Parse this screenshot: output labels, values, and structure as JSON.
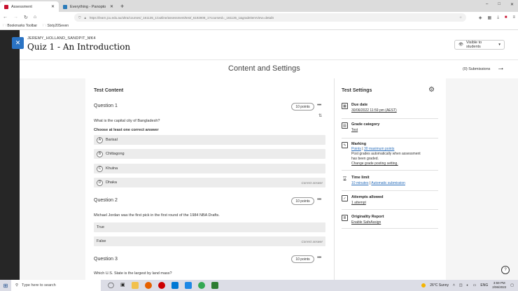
{
  "browser": {
    "tabs": [
      {
        "title": "Assessment",
        "active": true
      },
      {
        "title": "Everything - Panopto",
        "active": false
      }
    ],
    "new_tab": "+",
    "window_controls": [
      "–",
      "□",
      "✕"
    ],
    "url": "https://learn.jcu.edu.au/ultra/courses/_161135_1/outline/assessment/test/_6192808_1?courseId=_161135_1&gradeitemView=details",
    "bookmarks": [
      "Bookmarks Toolbar",
      "Sixty20Seven"
    ]
  },
  "header": {
    "user": "JEREMY_HOLLAND_SANDPIT_MK4",
    "title": "Quiz 1 - An Introduction",
    "visibility": "Visible to students",
    "visibility_caret": "▾",
    "close": "✕"
  },
  "subheader": {
    "title": "Content and Settings",
    "submissions": "(0) Submissions",
    "arrow": "→"
  },
  "test_content": {
    "heading": "Test Content",
    "questions": [
      {
        "label": "Question 1",
        "points": "10 points",
        "text": "What is the capital city of Bangladesh?",
        "instruction": "Choose at least one correct answer",
        "options": [
          {
            "letter": "A",
            "text": "Barisal",
            "correct": ""
          },
          {
            "letter": "B",
            "text": "Chittagong",
            "correct": ""
          },
          {
            "letter": "C",
            "text": "Khulna",
            "correct": ""
          },
          {
            "letter": "D",
            "text": "Dhaka",
            "correct": "Correct answer"
          }
        ]
      },
      {
        "label": "Question 2",
        "points": "10 points",
        "text": "Michael Jordan was the first pick in the first round of the 1984 NBA Drafts.",
        "options": [
          {
            "text": "True",
            "correct": ""
          },
          {
            "text": "False",
            "correct": "Correct answer"
          }
        ]
      },
      {
        "label": "Question 3",
        "points": "10 points",
        "text": "Which U.S. State is the largest by land mass?"
      }
    ],
    "more": "•••",
    "sort": "⇅"
  },
  "test_settings": {
    "heading": "Test Settings",
    "due_date": {
      "label": "Due date",
      "value": "30/06/2022 11:59 pm (AEST)"
    },
    "grade_category": {
      "label": "Grade category",
      "value": "Test"
    },
    "marking": {
      "label": "Marking",
      "points": "Points",
      "separator": "|",
      "max": "30 maximum points",
      "note_line1": "Post grades automatically when assessment",
      "note_line2": "has been graded.",
      "link": "Change grade posting setting."
    },
    "time_limit": {
      "label": "Time limit",
      "minutes": "10 minutes",
      "separator": "|",
      "auto": "Automatic submission"
    },
    "attempts": {
      "label": "Attempts allowed",
      "value": "1 attempt"
    },
    "originality": {
      "label": "Originality Report",
      "value": "Enable SafeAssign"
    }
  },
  "help": "?",
  "taskbar": {
    "search_placeholder": "Type here to search",
    "weather": "26°C  Sunny",
    "lang": "ENG",
    "time": "3:59 PM",
    "date": "2/06/2022"
  },
  "colors": {
    "accent_blue": "#2a73c4",
    "link": "#2a6ebb",
    "left_strip": "#262626"
  }
}
